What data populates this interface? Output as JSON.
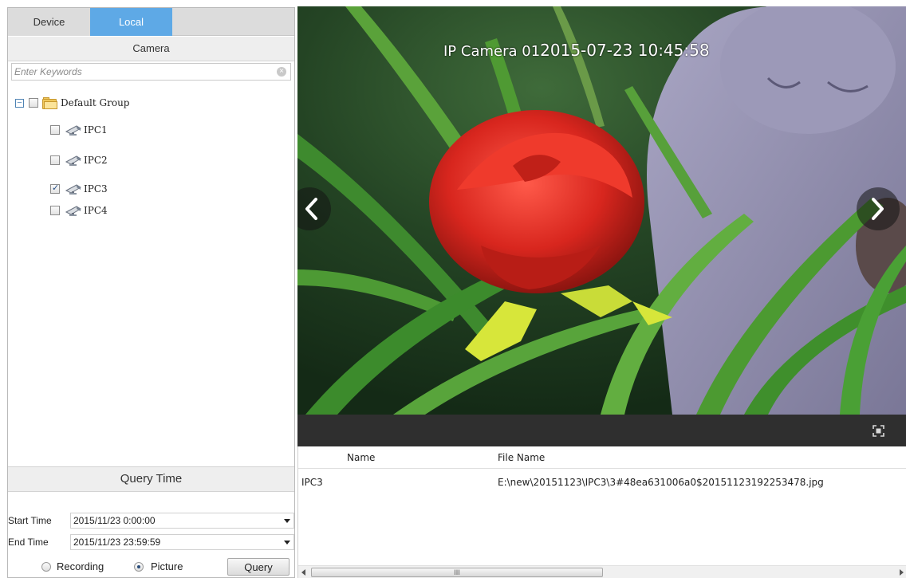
{
  "tabs": {
    "device": "Device",
    "local": "Local"
  },
  "camera_panel": {
    "title": "Camera",
    "search": {
      "placeholder": "Enter Keywords",
      "value": ""
    },
    "group": {
      "label": "Default Group",
      "expanded": true,
      "checked": false
    },
    "cameras": [
      {
        "label": "IPC1",
        "checked": false
      },
      {
        "label": "IPC2",
        "checked": false
      },
      {
        "label": "IPC3",
        "checked": true
      },
      {
        "label": "IPC4",
        "checked": false
      }
    ]
  },
  "query_time": {
    "title": "Query Time",
    "start_label": "Start Time",
    "start_value": "2015/11/23 0:00:00",
    "end_label": "End Time",
    "end_value": "2015/11/23 23:59:59",
    "type_recording": "Recording",
    "type_picture": "Picture",
    "selected_type": "Picture",
    "query_button": "Query"
  },
  "viewer": {
    "osd_text": "IP Camera 01",
    "osd_timestamp": "2015-07-23 10:45:58"
  },
  "results": {
    "columns": [
      "Name",
      "File Name"
    ],
    "rows": [
      {
        "name": "IPC3",
        "file_name": "E:\\new\\20151123\\IPC3\\3#48ea631006a0$20151123192253478.jpg"
      }
    ],
    "scroll_thumb_label": "III"
  },
  "icons": {
    "search_clear": "clear-icon",
    "expander": "collapse-icon",
    "folder": "folder-icon",
    "camera": "camera-icon",
    "prev": "chevron-left-icon",
    "next": "chevron-right-icon",
    "fullscreen": "fullscreen-icon"
  },
  "colors": {
    "active_tab": "#5ea9e6",
    "toolbar": "#2f2f2f"
  }
}
